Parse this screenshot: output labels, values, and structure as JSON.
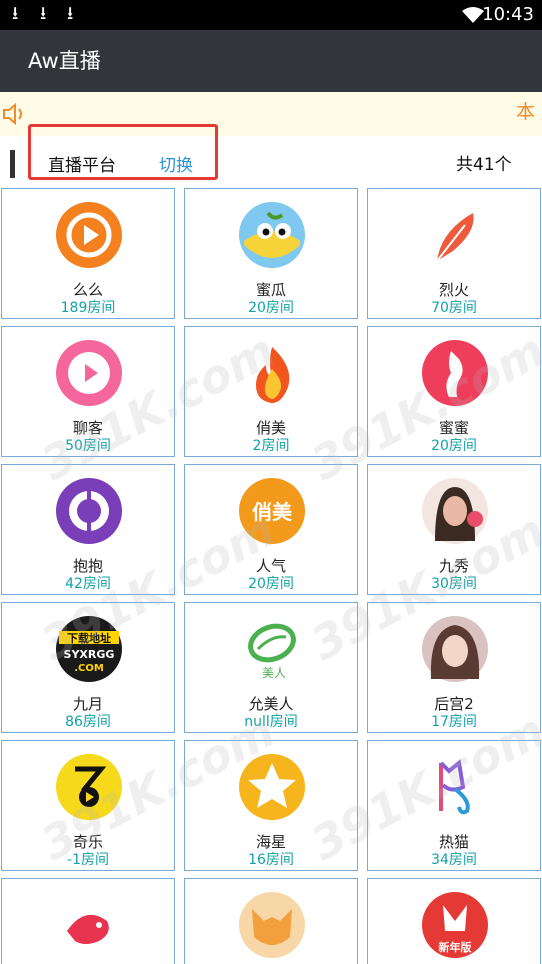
{
  "status_bar": {
    "time": "10:43",
    "download_icons": [
      "download-icon",
      "download-icon",
      "download-icon"
    ],
    "wifi_icon": "wifi-icon"
  },
  "app_bar": {
    "title": "Aw直播"
  },
  "notice": {
    "icon": "speaker-icon",
    "text": "本"
  },
  "header": {
    "label": "直播平台",
    "switch_label": "切换",
    "total": "共41个"
  },
  "platforms": [
    {
      "name": "么么",
      "rooms": "189房间",
      "icon": "memo-play-icon",
      "color": "#f4801f"
    },
    {
      "name": "蜜瓜",
      "rooms": "20房间",
      "icon": "melon-face-icon",
      "color": "#f7d33a"
    },
    {
      "name": "烈火",
      "rooms": "70房间",
      "icon": "feather-icon",
      "color": "#ee5a3b"
    },
    {
      "name": "聊客",
      "rooms": "50房间",
      "icon": "chat-play-icon",
      "color": "#f4669c"
    },
    {
      "name": "俏美",
      "rooms": "2房间",
      "icon": "flame-icon",
      "color": "#f28020"
    },
    {
      "name": "蜜蜜",
      "rooms": "20房间",
      "icon": "dancer-icon",
      "color": "#ef3d5c"
    },
    {
      "name": "抱抱",
      "rooms": "42房间",
      "icon": "ring-icon",
      "color": "#7a3fb8"
    },
    {
      "name": "人气",
      "rooms": "20房间",
      "icon": "qiaomei-badge-icon",
      "color": "#f39a1c",
      "badge": "俏美"
    },
    {
      "name": "九秀",
      "rooms": "30房间",
      "icon": "avatar-girl-icon",
      "color": "#e9b9a6"
    },
    {
      "name": "九月",
      "rooms": "86房间",
      "icon": "download-site-badge-icon",
      "color": "#1a1a1a",
      "badge": "下载地址",
      "badge2": "SYXRGG",
      "badge3": ".COM"
    },
    {
      "name": "允美人",
      "rooms": "null房间",
      "icon": "yunmeiren-logo-icon",
      "color": "#4caf50",
      "badge": "美人"
    },
    {
      "name": "后宫2",
      "rooms": "17房间",
      "icon": "avatar-woman-icon",
      "color": "#c27a7a"
    },
    {
      "name": "奇乐",
      "rooms": "-1房间",
      "icon": "qile-logo-icon",
      "color": "#f7d91c"
    },
    {
      "name": "海星",
      "rooms": "16房间",
      "icon": "star-icon",
      "color": "#f6b51c"
    },
    {
      "name": "热猫",
      "rooms": "34房间",
      "icon": "cat-logo-icon",
      "color": "#e24c7a"
    },
    {
      "name": "",
      "rooms": "",
      "icon": "fish-icon",
      "color": "#e8334f"
    },
    {
      "name": "",
      "rooms": "",
      "icon": "fox-icon",
      "color": "#f2a03d"
    },
    {
      "name": "",
      "rooms": "",
      "icon": "new-year-logo-icon",
      "color": "#e53935",
      "badge": "新年版"
    }
  ],
  "watermark": "391K.com"
}
